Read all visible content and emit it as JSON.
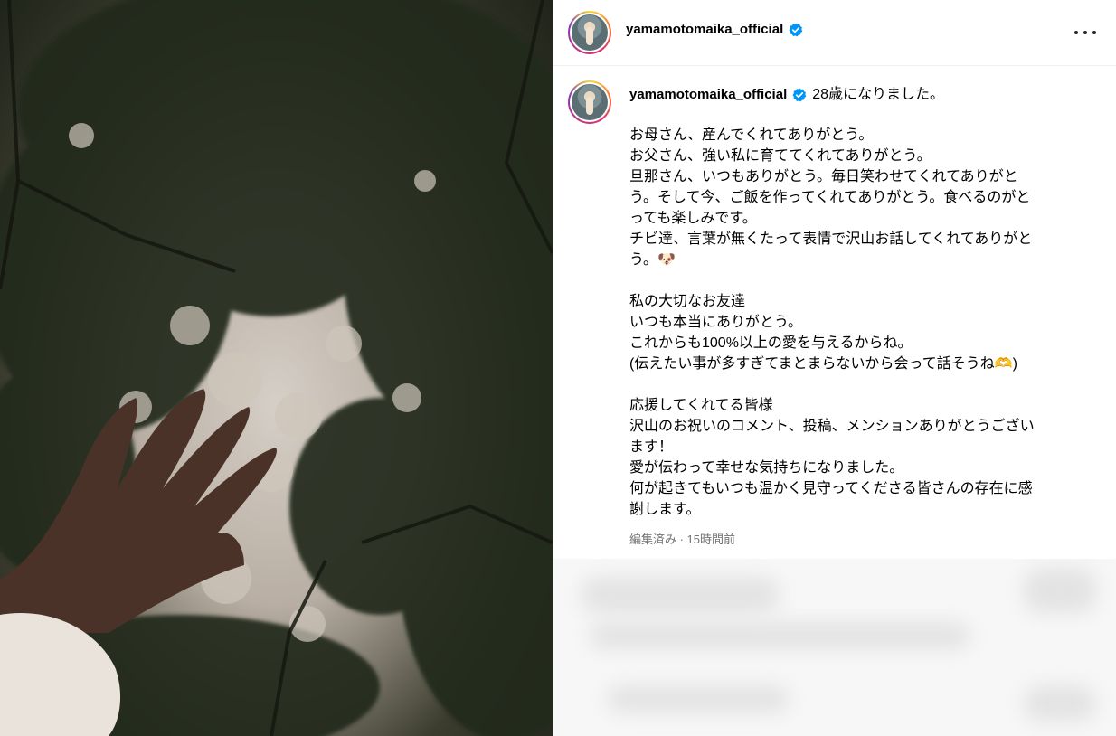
{
  "header": {
    "username": "yamamotomaika_official"
  },
  "caption": {
    "username": "yamamotomaika_official",
    "lines": [
      "28歳になりました。",
      "",
      "お母さん、産んでくれてありがとう。",
      "お父さん、強い私に育ててくれてありがとう。",
      "旦那さん、いつもありがとう。毎日笑わせてくれてありがと",
      "う。そして今、ご飯を作ってくれてありがとう。食べるのがと",
      "っても楽しみです。",
      "チビ達、言葉が無くたって表情で沢山お話してくれてありがと",
      "う。🐶",
      "",
      "私の大切なお友達",
      "いつも本当にありがとう。",
      "これからも100%以上の愛を与えるからね。",
      "(伝えたい事が多すぎてまとまらないから会って話そうね🫶)",
      "",
      "応援してくれてる皆様",
      "沢山のお祝いのコメント、投稿、メンションありがとうござい",
      "ます！",
      "愛が伝わって幸せな気持ちになりました。",
      "何が起きてもいつも温かく見守ってくださる皆さんの存在に感",
      "謝します。"
    ],
    "meta": "編集済み · 15時間前"
  },
  "icons": {
    "verified": "verified-badge-icon",
    "more": "more-options-icon"
  },
  "colors": {
    "verified": "#0095f6",
    "meta_text": "#737373"
  }
}
